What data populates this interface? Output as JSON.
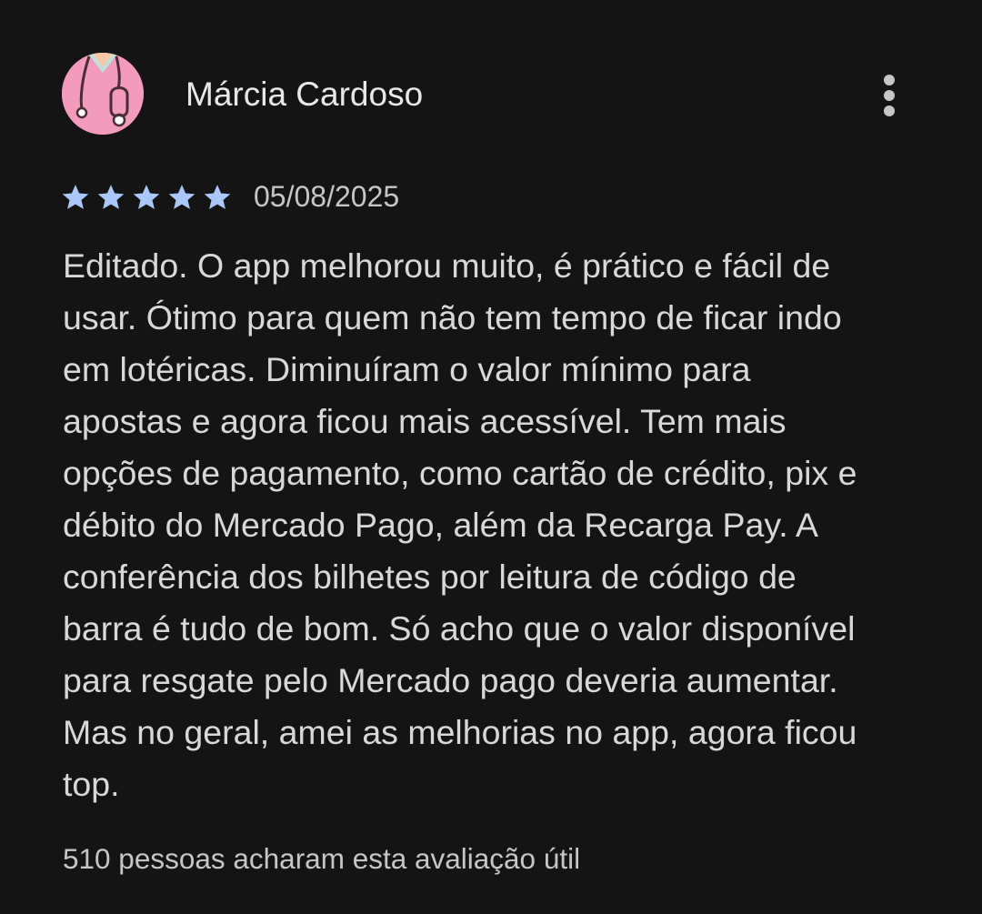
{
  "review": {
    "author": {
      "name": "Márcia Cardoso",
      "avatar_icon": "doctor-stethoscope-avatar-icon",
      "avatar_color": "#f49bbd"
    },
    "menu_icon": "more-vert-icon",
    "rating": {
      "stars": 5,
      "max": 5,
      "star_color": "#a8c7fa"
    },
    "date": "05/08/2025",
    "text_lines": [
      "Editado. O app melhorou muito, é prático e fácil de",
      "usar. Ótimo para quem não tem tempo de ficar indo",
      "em lotéricas. Diminuíram o valor mínimo para",
      "apostas e agora ficou mais acessível. Tem mais",
      "opções de pagamento, como cartão de crédito, pix e",
      "débito do Mercado Pago, além da Recarga Pay. A",
      "conferência dos bilhetes por leitura de código de",
      "barra é tudo de bom. Só acho que o valor disponível",
      "para resgate pelo Mercado pago deveria aumentar.",
      "Mas no geral, amei as melhorias no app, agora ficou",
      "top."
    ],
    "helpful_text": "510 pessoas acharam esta avaliação útil"
  },
  "theme": {
    "background": "#141414",
    "text_primary": "#e3e3e3",
    "text_secondary": "#c4c7c5"
  }
}
